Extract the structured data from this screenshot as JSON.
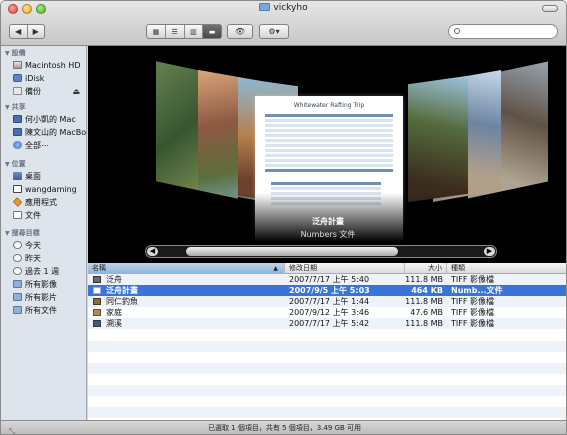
{
  "window": {
    "title": "vickyho"
  },
  "toolbar": {
    "back": "◀",
    "forward": "▶",
    "views": [
      "▦",
      "☰",
      "▥",
      "▬"
    ],
    "eye": "👁",
    "gear": "⚙▾",
    "search_placeholder": ""
  },
  "sidebar": {
    "devices_header": "設備",
    "devices": [
      {
        "label": "Macintosh HD",
        "icon": "hard-disk-icon"
      },
      {
        "label": "iDisk",
        "icon": "idisk-icon"
      },
      {
        "label": "備份",
        "icon": "backup-icon",
        "eject": "⏏"
      }
    ],
    "shared_header": "共享",
    "shared": [
      {
        "label": "何小凱的 Mac",
        "icon": "mac-icon"
      },
      {
        "label": "陳文山的 MacBook",
        "icon": "macbook-icon"
      },
      {
        "label": "全部⋯",
        "icon": "globe-icon"
      }
    ],
    "places_header": "位置",
    "places": [
      {
        "label": "桌面",
        "icon": "desktop-icon"
      },
      {
        "label": "wangdaming",
        "icon": "home-icon"
      },
      {
        "label": "應用程式",
        "icon": "applications-icon"
      },
      {
        "label": "文件",
        "icon": "documents-icon"
      }
    ],
    "search_header": "搜尋目標",
    "search_for": [
      {
        "label": "今天",
        "icon": "clock-icon"
      },
      {
        "label": "昨天",
        "icon": "clock-icon"
      },
      {
        "label": "過去 1 週",
        "icon": "clock-icon"
      },
      {
        "label": "所有影像",
        "icon": "smart-folder-icon"
      },
      {
        "label": "所有影片",
        "icon": "smart-folder-icon"
      },
      {
        "label": "所有文件",
        "icon": "smart-folder-icon"
      }
    ]
  },
  "coverflow": {
    "doc_title": "Whitewater Rafting Trip",
    "selected_name": "泛舟計畫",
    "selected_kind": "Numbers 文件",
    "scroll_left": "◀",
    "scroll_right": "▶"
  },
  "list": {
    "columns": {
      "name": "名稱",
      "date": "修改日期",
      "size": "大小",
      "kind": "種類"
    },
    "sort_indicator": "▲",
    "rows": [
      {
        "name": "泛舟",
        "date": "2007/7/17 上午 5:40",
        "size": "111.8 MB",
        "kind": "TIFF 影像檔",
        "icon": "tiff-icon",
        "selected": false
      },
      {
        "name": "泛舟計畫",
        "date": "2007/9/5 上午 5:03",
        "size": "464 KB",
        "kind": "Numb...文件",
        "icon": "numbers-icon",
        "selected": true
      },
      {
        "name": "同仁釣魚",
        "date": "2007/7/17 上午 1:44",
        "size": "111.8 MB",
        "kind": "TIFF 影像檔",
        "icon": "tiff-icon",
        "selected": false
      },
      {
        "name": "家庭",
        "date": "2007/9/12 上午 3:46",
        "size": "47.6 MB",
        "kind": "TIFF 影像檔",
        "icon": "tiff-icon",
        "selected": false
      },
      {
        "name": "溯溪",
        "date": "2007/7/17 上午 5:42",
        "size": "111.8 MB",
        "kind": "TIFF 影像檔",
        "icon": "tiff-icon",
        "selected": false
      }
    ]
  },
  "status": {
    "text": "已選取 1 個項目，共有 5 個項目，3.49 GB 可用",
    "grip": "⤡"
  }
}
